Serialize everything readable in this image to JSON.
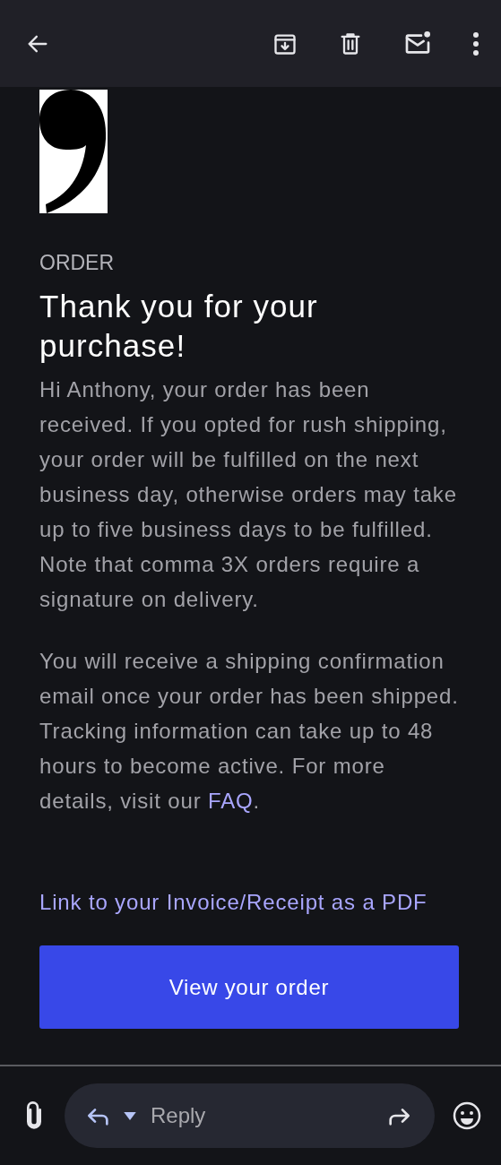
{
  "email": {
    "eyebrow": "ORDER",
    "title": "Thank you for your purchase!",
    "paragraphs": [
      {
        "text": "Hi Anthony, your order has been received. If you opted for rush shipping, your order will be fulfilled on the next business day, otherwise orders may take up to five business days to be fulfilled. Note that comma 3X orders require a signature on delivery."
      },
      {
        "text": "You will receive a shipping confirmation email once your order has been shipped. Tracking information can take up to 48 hours to become active. For more details, visit our ",
        "link": "FAQ",
        "after": "."
      }
    ],
    "invoice_link": "Link to your Invoice/Receipt as a PDF",
    "button": "View your order"
  },
  "reply_bar": {
    "placeholder": "Reply"
  }
}
